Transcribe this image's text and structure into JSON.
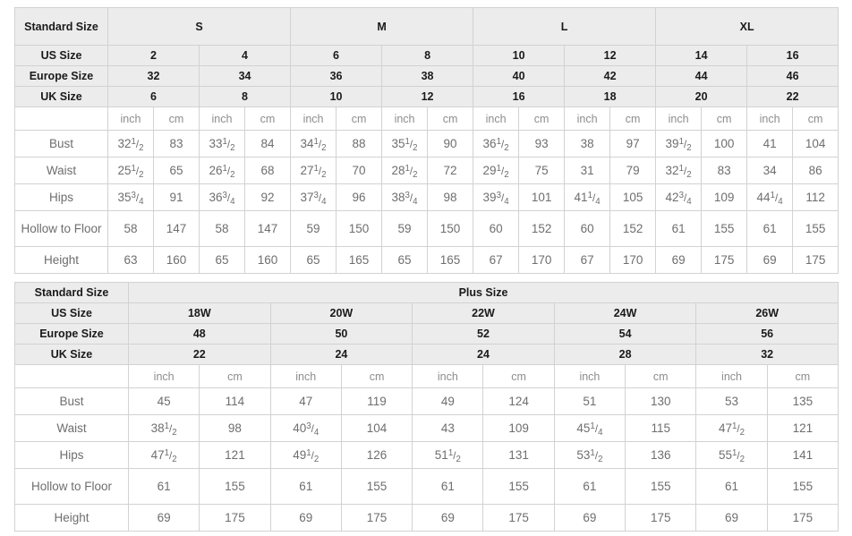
{
  "standard_table": {
    "row_header_labels": {
      "standard_size": "Standard Size",
      "us_size": "US Size",
      "europe_size": "Europe Size",
      "uk_size": "UK Size"
    },
    "standard_size_groups": [
      {
        "label": "S",
        "span": 4
      },
      {
        "label": "M",
        "span": 4
      },
      {
        "label": "L",
        "span": 4
      },
      {
        "label": "XL",
        "span": 4
      }
    ],
    "us_sizes": [
      "2",
      "4",
      "6",
      "8",
      "10",
      "12",
      "14",
      "16"
    ],
    "europe_sizes": [
      "32",
      "34",
      "36",
      "38",
      "40",
      "42",
      "44",
      "46"
    ],
    "uk_sizes": [
      "6",
      "8",
      "10",
      "12",
      "16",
      "18",
      "20",
      "22"
    ],
    "units": [
      "inch",
      "cm",
      "inch",
      "cm",
      "inch",
      "cm",
      "inch",
      "cm",
      "inch",
      "cm",
      "inch",
      "cm",
      "inch",
      "cm",
      "inch",
      "cm"
    ],
    "measurements": [
      {
        "label": "Bust",
        "values": [
          {
            "whole": "32",
            "num": "1",
            "den": "2"
          },
          {
            "whole": "83"
          },
          {
            "whole": "33",
            "num": "1",
            "den": "2"
          },
          {
            "whole": "84"
          },
          {
            "whole": "34",
            "num": "1",
            "den": "2"
          },
          {
            "whole": "88"
          },
          {
            "whole": "35",
            "num": "1",
            "den": "2"
          },
          {
            "whole": "90"
          },
          {
            "whole": "36",
            "num": "1",
            "den": "2"
          },
          {
            "whole": "93"
          },
          {
            "whole": "38"
          },
          {
            "whole": "97"
          },
          {
            "whole": "39",
            "num": "1",
            "den": "2"
          },
          {
            "whole": "100"
          },
          {
            "whole": "41"
          },
          {
            "whole": "104"
          }
        ]
      },
      {
        "label": "Waist",
        "values": [
          {
            "whole": "25",
            "num": "1",
            "den": "2"
          },
          {
            "whole": "65"
          },
          {
            "whole": "26",
            "num": "1",
            "den": "2"
          },
          {
            "whole": "68"
          },
          {
            "whole": "27",
            "num": "1",
            "den": "2"
          },
          {
            "whole": "70"
          },
          {
            "whole": "28",
            "num": "1",
            "den": "2"
          },
          {
            "whole": "72"
          },
          {
            "whole": "29",
            "num": "1",
            "den": "2"
          },
          {
            "whole": "75"
          },
          {
            "whole": "31"
          },
          {
            "whole": "79"
          },
          {
            "whole": "32",
            "num": "1",
            "den": "2"
          },
          {
            "whole": "83"
          },
          {
            "whole": "34"
          },
          {
            "whole": "86"
          }
        ]
      },
      {
        "label": "Hips",
        "values": [
          {
            "whole": "35",
            "num": "3",
            "den": "4"
          },
          {
            "whole": "91"
          },
          {
            "whole": "36",
            "num": "3",
            "den": "4"
          },
          {
            "whole": "92"
          },
          {
            "whole": "37",
            "num": "3",
            "den": "4"
          },
          {
            "whole": "96"
          },
          {
            "whole": "38",
            "num": "3",
            "den": "4"
          },
          {
            "whole": "98"
          },
          {
            "whole": "39",
            "num": "3",
            "den": "4"
          },
          {
            "whole": "101"
          },
          {
            "whole": "41",
            "num": "1",
            "den": "4"
          },
          {
            "whole": "105"
          },
          {
            "whole": "42",
            "num": "3",
            "den": "4"
          },
          {
            "whole": "109"
          },
          {
            "whole": "44",
            "num": "1",
            "den": "4"
          },
          {
            "whole": "112"
          }
        ]
      },
      {
        "label": "Hollow to Floor",
        "tall": true,
        "values": [
          {
            "whole": "58"
          },
          {
            "whole": "147"
          },
          {
            "whole": "58"
          },
          {
            "whole": "147"
          },
          {
            "whole": "59"
          },
          {
            "whole": "150"
          },
          {
            "whole": "59"
          },
          {
            "whole": "150"
          },
          {
            "whole": "60"
          },
          {
            "whole": "152"
          },
          {
            "whole": "60"
          },
          {
            "whole": "152"
          },
          {
            "whole": "61"
          },
          {
            "whole": "155"
          },
          {
            "whole": "61"
          },
          {
            "whole": "155"
          }
        ]
      },
      {
        "label": "Height",
        "values": [
          {
            "whole": "63"
          },
          {
            "whole": "160"
          },
          {
            "whole": "65"
          },
          {
            "whole": "160"
          },
          {
            "whole": "65"
          },
          {
            "whole": "165"
          },
          {
            "whole": "65"
          },
          {
            "whole": "165"
          },
          {
            "whole": "67"
          },
          {
            "whole": "170"
          },
          {
            "whole": "67"
          },
          {
            "whole": "170"
          },
          {
            "whole": "69"
          },
          {
            "whole": "175"
          },
          {
            "whole": "69"
          },
          {
            "whole": "175"
          }
        ]
      }
    ]
  },
  "plus_table": {
    "row_header_labels": {
      "standard_size": "Standard Size",
      "us_size": "US Size",
      "europe_size": "Europe Size",
      "uk_size": "UK Size"
    },
    "group_label": "Plus Size",
    "us_sizes": [
      "18W",
      "20W",
      "22W",
      "24W",
      "26W"
    ],
    "europe_sizes": [
      "48",
      "50",
      "52",
      "54",
      "56"
    ],
    "uk_sizes": [
      "22",
      "24",
      "24",
      "28",
      "32"
    ],
    "units": [
      "inch",
      "cm",
      "inch",
      "cm",
      "inch",
      "cm",
      "inch",
      "cm",
      "inch",
      "cm"
    ],
    "measurements": [
      {
        "label": "Bust",
        "values": [
          {
            "whole": "45"
          },
          {
            "whole": "114"
          },
          {
            "whole": "47"
          },
          {
            "whole": "119"
          },
          {
            "whole": "49"
          },
          {
            "whole": "124"
          },
          {
            "whole": "51"
          },
          {
            "whole": "130"
          },
          {
            "whole": "53"
          },
          {
            "whole": "135"
          }
        ]
      },
      {
        "label": "Waist",
        "values": [
          {
            "whole": "38",
            "num": "1",
            "den": "2"
          },
          {
            "whole": "98"
          },
          {
            "whole": "40",
            "num": "3",
            "den": "4"
          },
          {
            "whole": "104"
          },
          {
            "whole": "43"
          },
          {
            "whole": "109"
          },
          {
            "whole": "45",
            "num": "1",
            "den": "4"
          },
          {
            "whole": "115"
          },
          {
            "whole": "47",
            "num": "1",
            "den": "2"
          },
          {
            "whole": "121"
          }
        ]
      },
      {
        "label": "Hips",
        "values": [
          {
            "whole": "47",
            "num": "1",
            "den": "2"
          },
          {
            "whole": "121"
          },
          {
            "whole": "49",
            "num": "1",
            "den": "2"
          },
          {
            "whole": "126"
          },
          {
            "whole": "51",
            "num": "1",
            "den": "2"
          },
          {
            "whole": "131"
          },
          {
            "whole": "53",
            "num": "1",
            "den": "2"
          },
          {
            "whole": "136"
          },
          {
            "whole": "55",
            "num": "1",
            "den": "2"
          },
          {
            "whole": "141"
          }
        ]
      },
      {
        "label": "Hollow to Floor",
        "tall": true,
        "values": [
          {
            "whole": "61"
          },
          {
            "whole": "155"
          },
          {
            "whole": "61"
          },
          {
            "whole": "155"
          },
          {
            "whole": "61"
          },
          {
            "whole": "155"
          },
          {
            "whole": "61"
          },
          {
            "whole": "155"
          },
          {
            "whole": "61"
          },
          {
            "whole": "155"
          }
        ]
      },
      {
        "label": "Height",
        "values": [
          {
            "whole": "69"
          },
          {
            "whole": "175"
          },
          {
            "whole": "69"
          },
          {
            "whole": "175"
          },
          {
            "whole": "69"
          },
          {
            "whole": "175"
          },
          {
            "whole": "69"
          },
          {
            "whole": "175"
          },
          {
            "whole": "69"
          },
          {
            "whole": "175"
          }
        ]
      }
    ]
  }
}
